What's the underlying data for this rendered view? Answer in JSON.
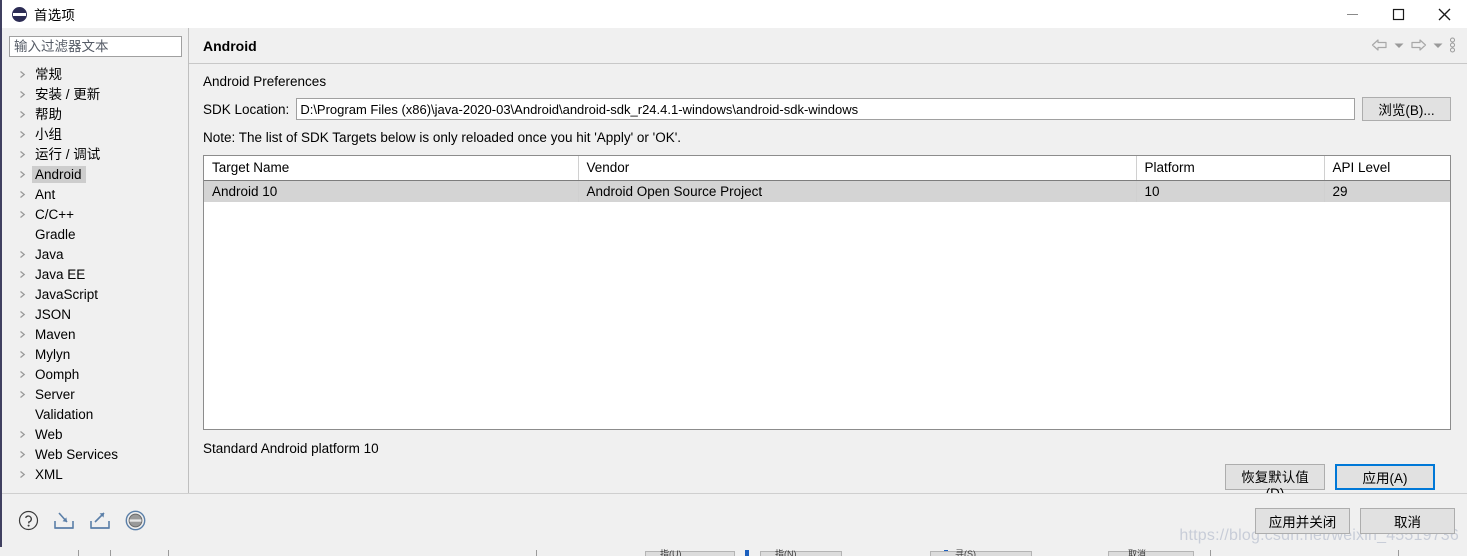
{
  "window": {
    "title": "首选项",
    "app_icon": "eclipse-icon",
    "controls": {
      "minimize": "minimize-icon",
      "maximize": "maximize-icon",
      "close": "close-icon"
    }
  },
  "sidebar": {
    "filter": {
      "placeholder": "输入过滤器文本",
      "value": ""
    },
    "items": [
      {
        "label": "常规",
        "expandable": true,
        "selected": false
      },
      {
        "label": "安装 / 更新",
        "expandable": true,
        "selected": false
      },
      {
        "label": "帮助",
        "expandable": true,
        "selected": false
      },
      {
        "label": "小组",
        "expandable": true,
        "selected": false
      },
      {
        "label": "运行 / 调试",
        "expandable": true,
        "selected": false
      },
      {
        "label": "Android",
        "expandable": true,
        "selected": true
      },
      {
        "label": "Ant",
        "expandable": true,
        "selected": false
      },
      {
        "label": "C/C++",
        "expandable": true,
        "selected": false
      },
      {
        "label": "Gradle",
        "expandable": false,
        "selected": false
      },
      {
        "label": "Java",
        "expandable": true,
        "selected": false
      },
      {
        "label": "Java EE",
        "expandable": true,
        "selected": false
      },
      {
        "label": "JavaScript",
        "expandable": true,
        "selected": false
      },
      {
        "label": "JSON",
        "expandable": true,
        "selected": false
      },
      {
        "label": "Maven",
        "expandable": true,
        "selected": false
      },
      {
        "label": "Mylyn",
        "expandable": true,
        "selected": false
      },
      {
        "label": "Oomph",
        "expandable": true,
        "selected": false
      },
      {
        "label": "Server",
        "expandable": true,
        "selected": false
      },
      {
        "label": "Validation",
        "expandable": false,
        "selected": false
      },
      {
        "label": "Web",
        "expandable": true,
        "selected": false
      },
      {
        "label": "Web Services",
        "expandable": true,
        "selected": false
      },
      {
        "label": "XML",
        "expandable": true,
        "selected": false
      }
    ]
  },
  "main": {
    "title": "Android",
    "nav": {
      "back": "back-arrow-icon",
      "back_dropdown": "chevron-down-icon",
      "forward": "forward-arrow-icon",
      "forward_dropdown": "chevron-down-icon",
      "menu": "vertical-dots-icon"
    },
    "preferences_label": "Android Preferences",
    "sdk_location": {
      "label": "SDK Location:",
      "value": "D:\\Program Files (x86)\\java-2020-03\\Android\\android-sdk_r24.4.1-windows\\android-sdk-windows",
      "browse_label": "浏览(B)..."
    },
    "note": "Note: The list of SDK Targets below is only reloaded once you hit 'Apply' or 'OK'.",
    "table": {
      "columns": [
        "Target Name",
        "Vendor",
        "Platform",
        "API Level"
      ],
      "rows": [
        {
          "target_name": "Android 10",
          "vendor": "Android Open Source Project",
          "platform": "10",
          "api_level": "29",
          "selected": true
        }
      ]
    },
    "status": "Standard Android platform 10",
    "restore_defaults_label": "恢复默认值(D)",
    "apply_label": "应用(A)"
  },
  "footer": {
    "icons": [
      "help-icon",
      "import-icon",
      "export-icon",
      "eclipse-badge-icon"
    ],
    "apply_and_close_label": "应用并关闭",
    "cancel_label": "取消",
    "watermark": "https://blog.csdn.net/weixin_45519736"
  },
  "background_taskbar": {
    "labels": [
      "指(U)",
      "指(N)",
      "寻(S)",
      "取消"
    ]
  },
  "colors": {
    "accent": "#0078d7",
    "window_bg": "#f0f0f0",
    "selection": "#d4d4d4",
    "tree_selection": "#cdcdcd",
    "border": "#a0a0a0",
    "watermark": "#c8cdd8"
  }
}
